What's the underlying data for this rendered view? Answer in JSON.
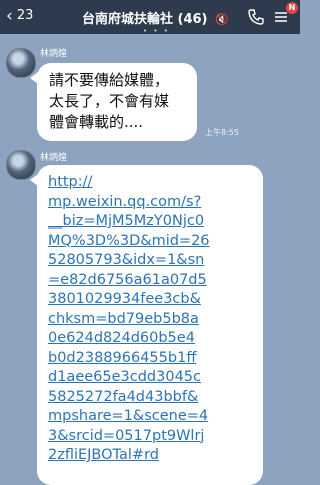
{
  "header": {
    "back_count": "23",
    "title": "台南府城扶輪社 (46)",
    "badge": "N"
  },
  "messages": [
    {
      "sender": "林炳煌",
      "lines": [
        "請不要傳給媒體，",
        "太長了，不會有媒",
        "體會轉載的...."
      ],
      "time": "上午8:55"
    },
    {
      "sender": "林炳煌",
      "lines": [
        "http://",
        "mp.weixin.qq.com/s?",
        "__biz=MjM5MzY0Njc0",
        "MQ%3D%3D&mid=26",
        "52805793&idx=1&sn",
        "=e82d6756a61a07d5",
        "3801029934fee3cb&",
        "chksm=bd79eb5b8a",
        "0e624d824d60b5e4",
        "b0d2388966455b1ff",
        "d1aee65e3cdd3045c",
        "5825272fa4d43bbf&",
        "mpshare=1&scene=4",
        "3&srcid=0517pt9Wlrj",
        "2zfliEJBOTal#rd"
      ]
    }
  ]
}
